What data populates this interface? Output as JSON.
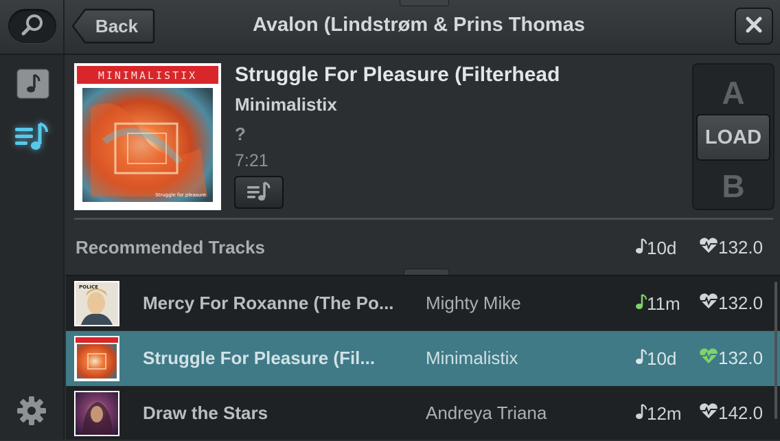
{
  "header": {
    "back_label": "Back",
    "title": "Avalon (Lindstrøm & Prins Thomas"
  },
  "rail": {
    "items": [
      {
        "icon": "music-note-icon"
      },
      {
        "icon": "playlist-icon",
        "active": true
      },
      {
        "icon": "gear-icon"
      }
    ]
  },
  "current_track": {
    "cover_text": "MINIMALISTIX",
    "cover_caption": "Struggle for pleasure",
    "title": "Struggle For Pleasure (Filterhead",
    "artist": "Minimalistix",
    "key": "?",
    "duration": "7:21"
  },
  "load_panel": {
    "deck_a": "A",
    "load_label": "LOAD",
    "deck_b": "B"
  },
  "recommended": {
    "label": "Recommended Tracks",
    "key": "10d",
    "bpm": "132.0"
  },
  "tracks": [
    {
      "title": "Mercy For Roxanne (The Po...",
      "artist": "Mighty Mike",
      "key": "11m",
      "bpm": "132.0",
      "key_color": "#7ed36a",
      "bpm_color": "#cfd3d6",
      "selected": false
    },
    {
      "title": "Struggle For Pleasure (Fil...",
      "artist": "Minimalistix",
      "key": "10d",
      "bpm": "132.0",
      "key_color": "#dbe6e9",
      "bpm_color": "#7ed36a",
      "selected": true
    },
    {
      "title": "Draw the Stars",
      "artist": "Andreya Triana",
      "key": "12m",
      "bpm": "142.0",
      "key_color": "#cfd3d6",
      "bpm_color": "#cfd3d6",
      "selected": false
    }
  ],
  "colors": {
    "accent": "#3f7a86",
    "active_icon": "#58c8ea",
    "match_green": "#7ed36a"
  }
}
